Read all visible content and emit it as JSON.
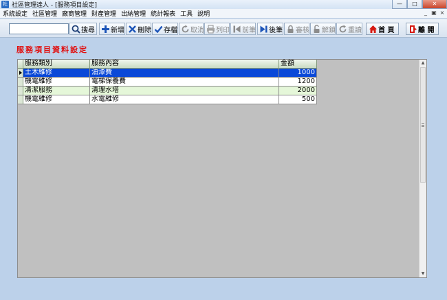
{
  "window": {
    "title": "社區管理達人 - [服務項目設定]",
    "app_icon_label": "社"
  },
  "menu": {
    "items": [
      "系統設定",
      "社區管理",
      "廠商管理",
      "財產管理",
      "出納管理",
      "統計報表",
      "工具",
      "說明"
    ]
  },
  "toolbar": {
    "search_value": "",
    "search_label": "搜尋",
    "add_label": "新增",
    "delete_label": "刪除",
    "save_label": "存檔",
    "cancel_label": "取消",
    "print_label": "列印",
    "prev_label": "前筆",
    "next_label": "後筆",
    "review_label": "審核",
    "unlock_label": "解鎖",
    "redo_label": "重讀",
    "home_label": "首 頁",
    "exit_label": "離 開"
  },
  "page": {
    "title": "服務項目資料設定"
  },
  "grid": {
    "columns": [
      "服務類別",
      "服務內容",
      "金額"
    ],
    "rows": [
      {
        "category": "土木維修",
        "content": "油漆費",
        "amount": "1000"
      },
      {
        "category": "機電維修",
        "content": "電梯保養費",
        "amount": "1200"
      },
      {
        "category": "清潔服務",
        "content": "清理水塔",
        "amount": "2000"
      },
      {
        "category": "機電維修",
        "content": "水電維修",
        "amount": "500"
      }
    ]
  },
  "colors": {
    "selected_row": "#0a48d8",
    "alt_row": "#e5f7d9",
    "title_red": "#e01010",
    "background": "#bcd1ea"
  }
}
